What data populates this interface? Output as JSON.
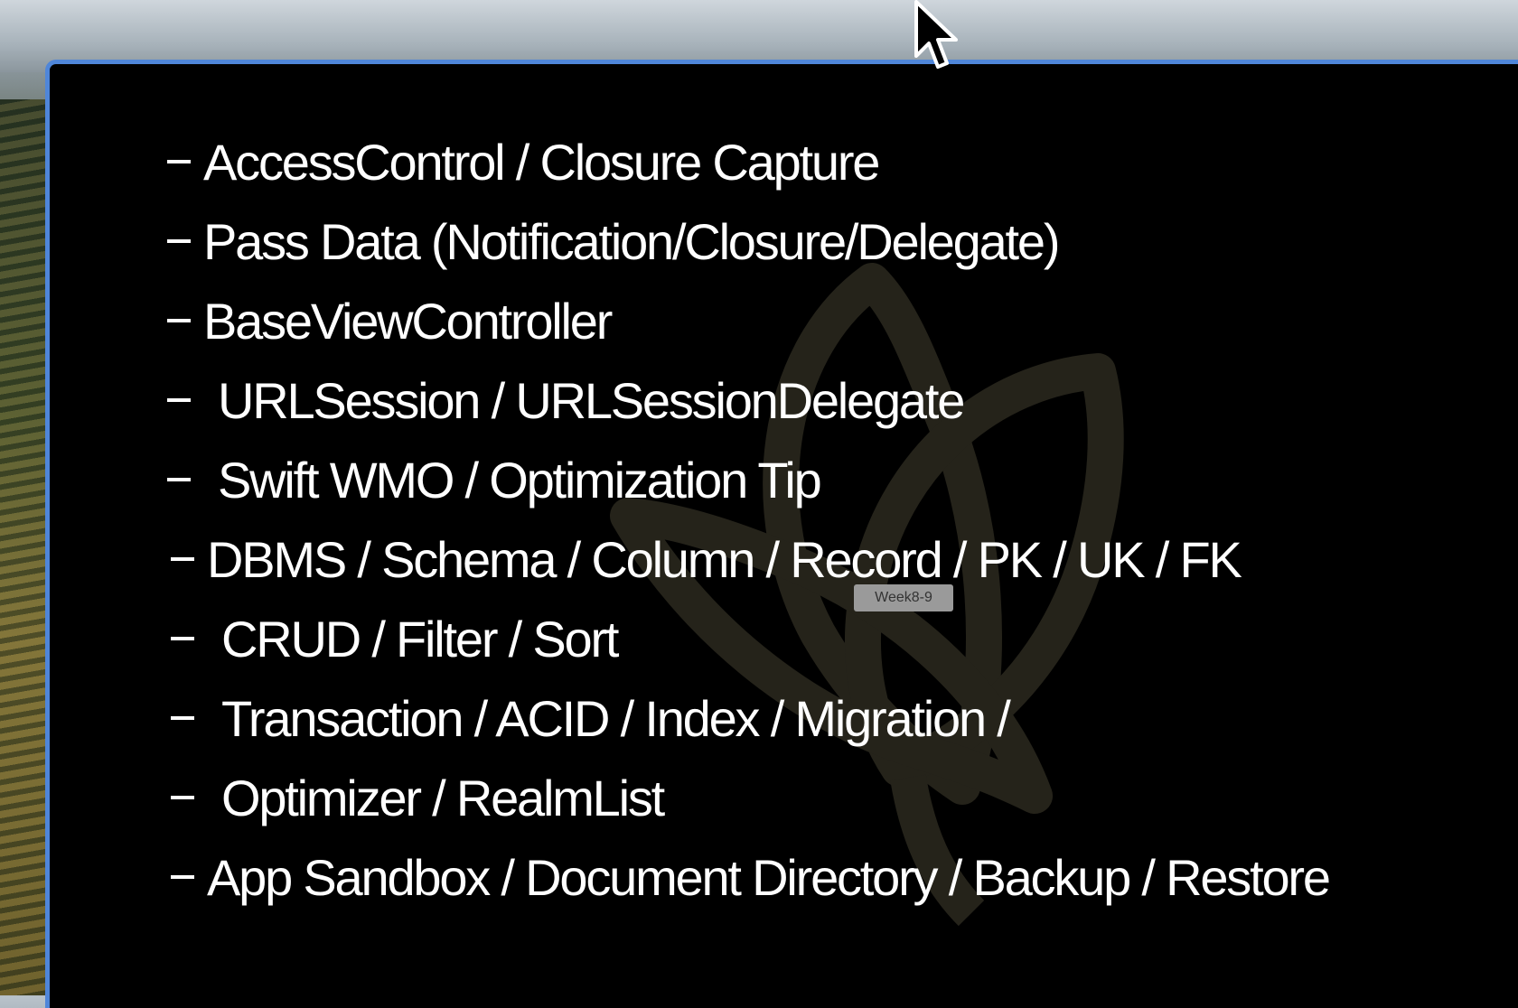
{
  "topics": [
    {
      "label": "AccessControl / Closure Capture"
    },
    {
      "label": "Pass Data (Notification/Closure/Delegate)"
    },
    {
      "label": "BaseViewController"
    },
    {
      "label": "URLSession / URLSessionDelegate"
    },
    {
      "label": "Swift WMO / Optimization Tip"
    },
    {
      "label": "DBMS / Schema / Column / Record / PK / UK / FK"
    },
    {
      "label": "CRUD / Filter / Sort"
    },
    {
      "label": "Transaction / ACID / Index / Migration /"
    },
    {
      "label": "Optimizer / RealmList"
    },
    {
      "label": "App Sandbox / Document Directory / Backup / Restore"
    }
  ],
  "tooltip": {
    "text": "Week8-9"
  },
  "colors": {
    "window_border": "#4f86d9",
    "background": "#000000",
    "text": "#ffffff"
  },
  "icons": {
    "cursor": "pointer-arrow-icon",
    "watermark": "leaf-logo-icon"
  }
}
